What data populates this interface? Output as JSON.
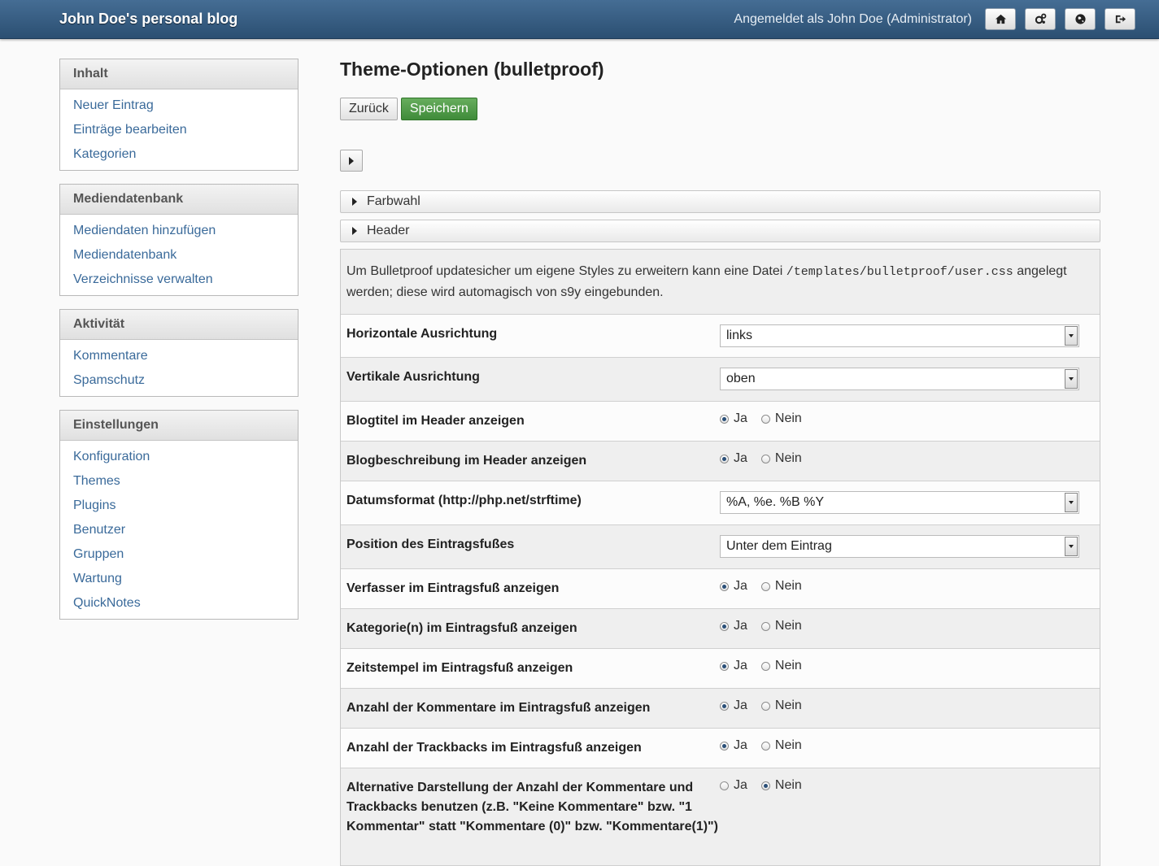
{
  "header": {
    "blog_title": "John Doe's personal blog",
    "logged_in": "Angemeldet als John Doe (Administrator)",
    "icons": [
      "home-icon",
      "settings-cogs-icon",
      "globe-icon",
      "logout-icon"
    ]
  },
  "sidebar": {
    "sections": [
      {
        "title": "Inhalt",
        "items": [
          "Neuer Eintrag",
          "Einträge bearbeiten",
          "Kategorien"
        ]
      },
      {
        "title": "Mediendatenbank",
        "items": [
          "Mediendaten hinzufügen",
          "Mediendatenbank",
          "Verzeichnisse verwalten"
        ]
      },
      {
        "title": "Aktivität",
        "items": [
          "Kommentare",
          "Spamschutz"
        ]
      },
      {
        "title": "Einstellungen",
        "items": [
          "Konfiguration",
          "Themes",
          "Plugins",
          "Benutzer",
          "Gruppen",
          "Wartung",
          "QuickNotes"
        ]
      }
    ]
  },
  "main": {
    "title": "Theme-Optionen (bulletproof)",
    "back_label": "Zurück",
    "save_label": "Speichern",
    "sections": [
      "Farbwahl",
      "Header"
    ],
    "info_pre": "Um Bulletproof updatesicher um eigene Styles zu erweitern kann eine Datei ",
    "info_code": "/templates/bulletproof/user.css",
    "info_post": " angelegt werden; diese wird automagisch von s9y eingebunden.",
    "yes_label": "Ja",
    "no_label": "Nein",
    "options": [
      {
        "label": "Horizontale Ausrichtung",
        "type": "select",
        "value": "links"
      },
      {
        "label": "Vertikale Ausrichtung",
        "type": "select",
        "value": "oben"
      },
      {
        "label": "Blogtitel im Header anzeigen",
        "type": "radio",
        "value": "Ja"
      },
      {
        "label": "Blogbeschreibung im Header anzeigen",
        "type": "radio",
        "value": "Ja"
      },
      {
        "label": "Datumsformat (http://php.net/strftime)",
        "type": "select",
        "value": "%A, %e. %B %Y"
      },
      {
        "label": "Position des Eintragsfußes",
        "type": "select",
        "value": "Unter dem Eintrag"
      },
      {
        "label": "Verfasser im Eintragsfuß anzeigen",
        "type": "radio",
        "value": "Ja"
      },
      {
        "label": "Kategorie(n) im Eintragsfuß anzeigen",
        "type": "radio",
        "value": "Ja"
      },
      {
        "label": "Zeitstempel im Eintragsfuß anzeigen",
        "type": "radio",
        "value": "Ja"
      },
      {
        "label": "Anzahl der Kommentare im Eintragsfuß anzeigen",
        "type": "radio",
        "value": "Ja"
      },
      {
        "label": "Anzahl der Trackbacks im Eintragsfuß anzeigen",
        "type": "radio",
        "value": "Ja"
      },
      {
        "label": "Alternative Darstellung der Anzahl der Kommentare und Trackbacks benutzen (z.B. \"Keine Kommentare\" bzw. \"1 Kommentar\" statt \"Kommentare (0)\" bzw. \"Kommentare(1)\")",
        "type": "radio",
        "value": "Nein"
      }
    ]
  }
}
